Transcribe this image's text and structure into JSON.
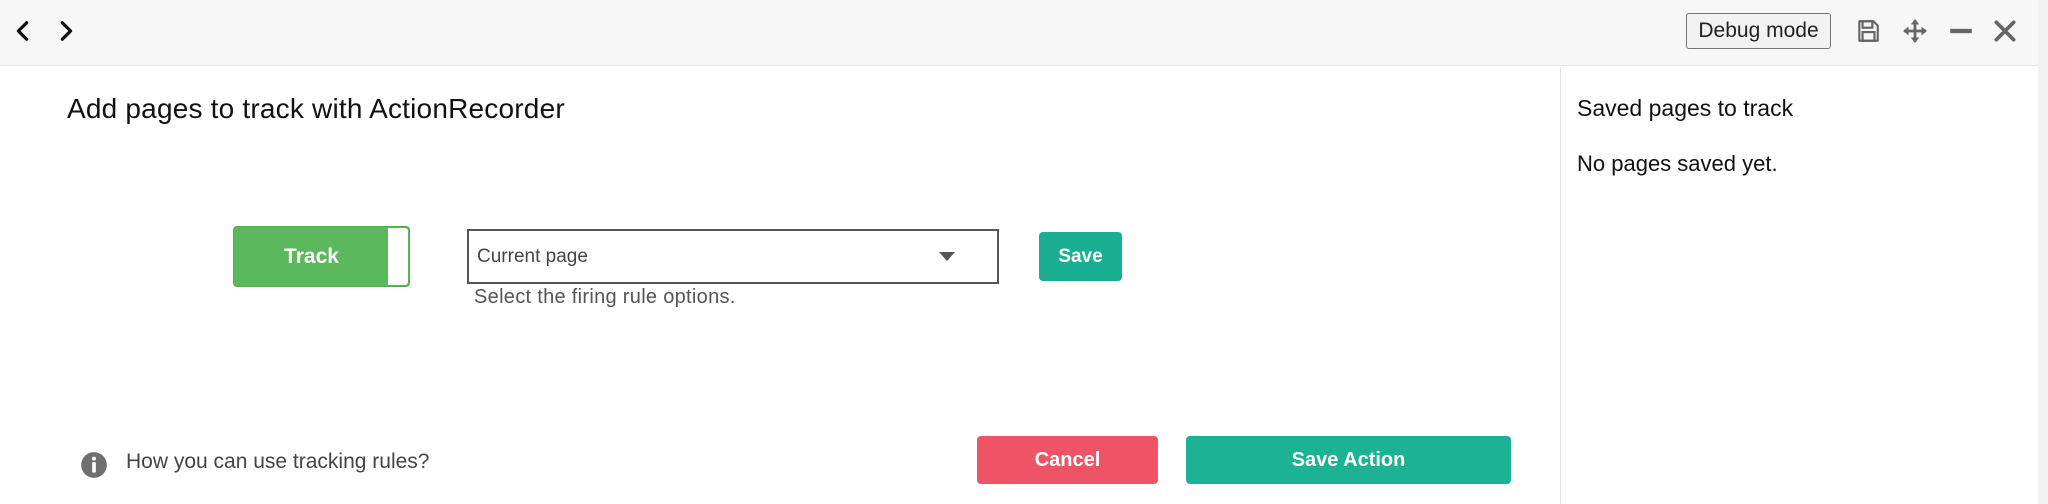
{
  "toolbar": {
    "back_icon": "chevron-left-icon",
    "forward_icon": "chevron-right-icon",
    "debug_label": "Debug mode",
    "save_icon": "floppy-disk-icon",
    "move_icon": "move-arrows-icon",
    "minimize_icon": "minus-icon",
    "close_icon": "close-icon"
  },
  "main": {
    "title": "Add pages to track with ActionRecorder",
    "track_label": "Track",
    "rule_select_value": "Current page",
    "rule_help": "Select the firing rule options.",
    "save_label": "Save",
    "tracking_rules_link": "How you can use tracking rules?",
    "cancel_label": "Cancel",
    "save_action_label": "Save Action"
  },
  "sidebar": {
    "title": "Saved pages to track",
    "empty_text": "No pages saved yet."
  },
  "colors": {
    "track_green": "#5cb85c",
    "teal": "#1bb394",
    "cancel_red": "#ef5466"
  }
}
